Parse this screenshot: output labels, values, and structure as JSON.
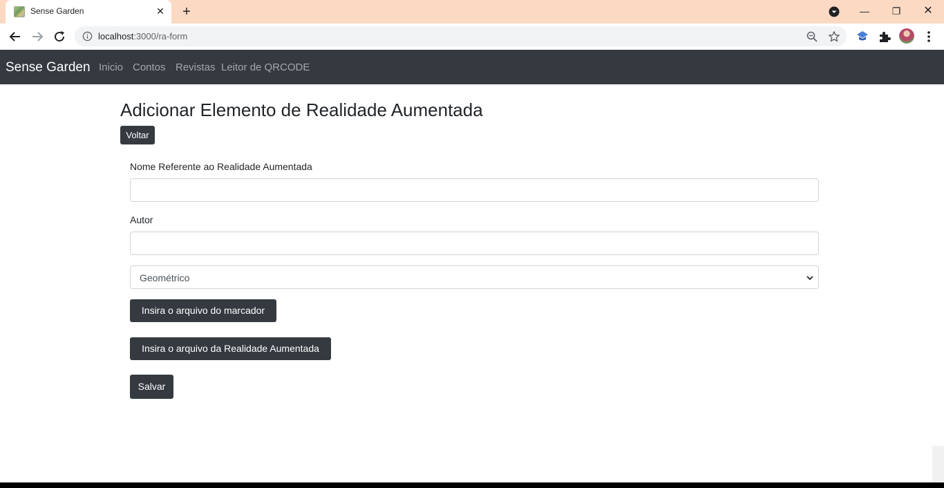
{
  "browser": {
    "tab_title": "Sense Garden",
    "url_host": "localhost",
    "url_path": ":3000/ra-form"
  },
  "navbar": {
    "brand": "Sense Garden",
    "links": [
      "Inicio",
      "Contos",
      "Revistas",
      "Leitor de QRCODE"
    ]
  },
  "page": {
    "title": "Adicionar Elemento de Realidade Aumentada",
    "back_button": "Voltar"
  },
  "form": {
    "name_label": "Nome Referente ao Realidade Aumentada",
    "name_value": "",
    "author_label": "Autor",
    "author_value": "",
    "type_selected": "Geométrico",
    "marker_button": "Insira o arquivo do marcador",
    "ar_button": "Insira o arquivo da Realidade Aumentada",
    "save_button": "Salvar"
  },
  "colors": {
    "tabstrip": "#fcd9c3",
    "navbar": "#343a40",
    "button_dark": "#343a40"
  }
}
